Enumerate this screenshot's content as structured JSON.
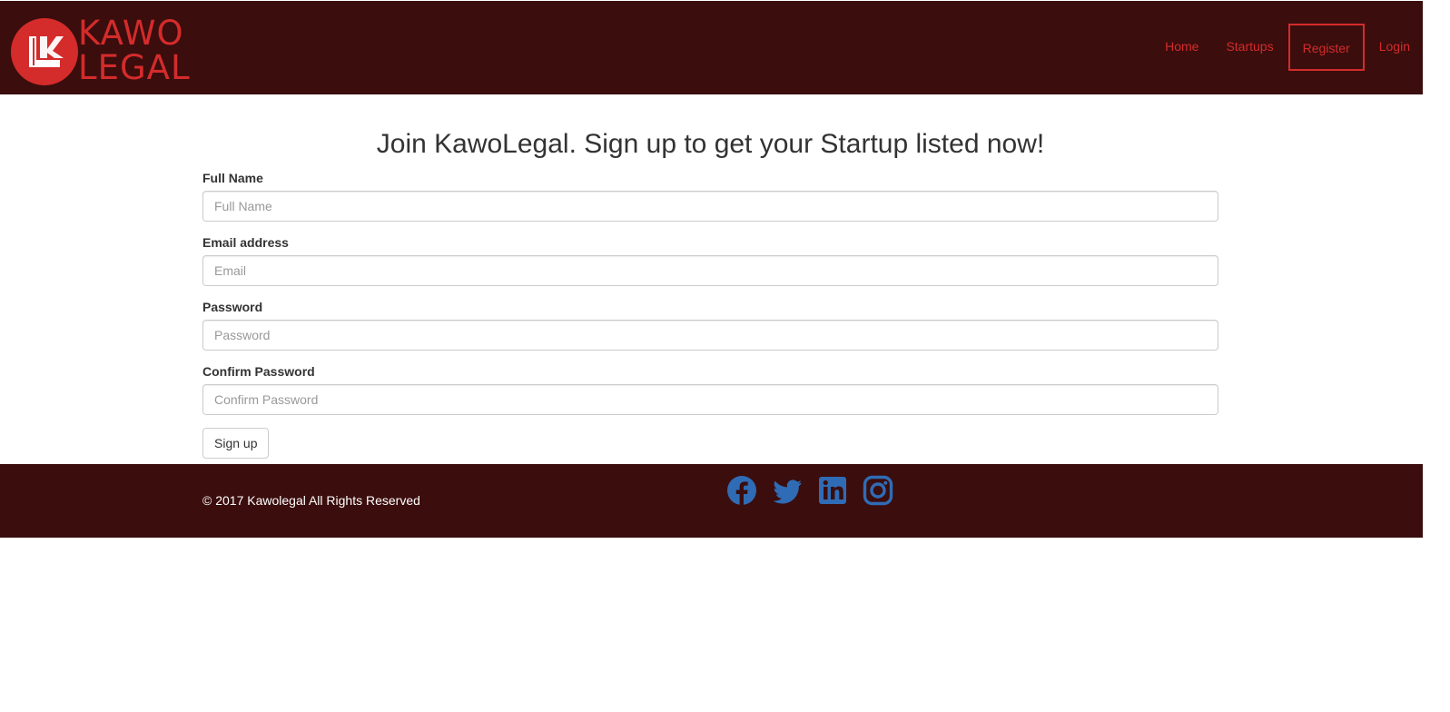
{
  "brand": {
    "logo_line1": "KAWO",
    "logo_line2": "LEGAL",
    "logo_mark": "LK",
    "accent_color": "#d42b2b",
    "header_color": "#3b0d0d"
  },
  "nav": {
    "home": "Home",
    "startups": "Startups",
    "register": "Register",
    "login": "Login"
  },
  "page": {
    "title": "Join KawoLegal. Sign up to get your Startup listed now!"
  },
  "form": {
    "full_name_label": "Full Name",
    "full_name_placeholder": "Full Name",
    "email_label": "Email address",
    "email_placeholder": "Email",
    "password_label": "Password",
    "password_placeholder": "Password",
    "confirm_label": "Confirm Password",
    "confirm_placeholder": "Confirm Password",
    "submit": "Sign up"
  },
  "footer": {
    "copyright": "© 2017 Kawolegal All Rights Reserved",
    "social_icon_color": "#2f6cb5",
    "social": [
      "facebook-icon",
      "twitter-icon",
      "linkedin-icon",
      "instagram-icon"
    ]
  }
}
